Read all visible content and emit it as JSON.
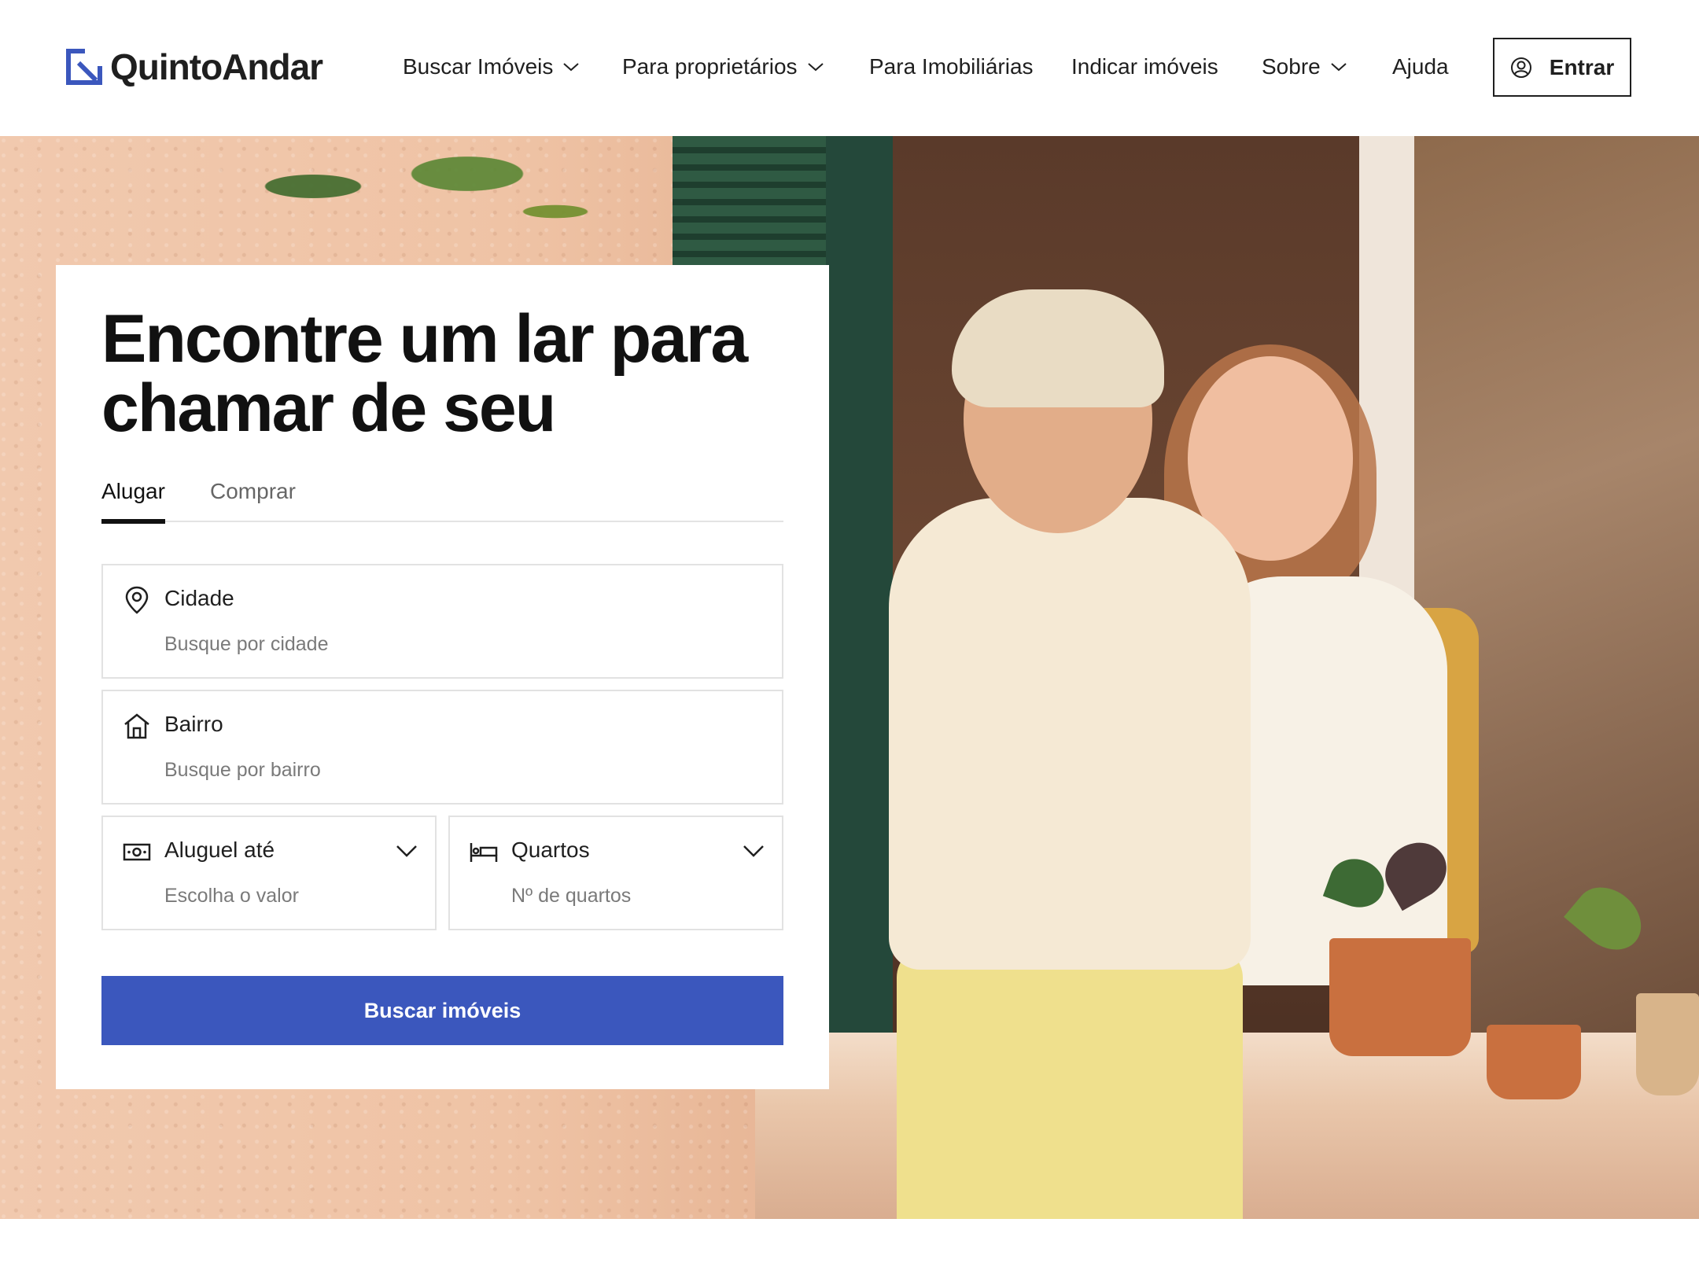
{
  "header": {
    "logo_text": "QuintoAndar",
    "nav": [
      {
        "label": "Buscar Imóveis",
        "has_dropdown": true
      },
      {
        "label": "Para proprietários",
        "has_dropdown": true
      },
      {
        "label": "Para Imobiliárias",
        "has_dropdown": false
      },
      {
        "label": "Indicar imóveis",
        "has_dropdown": false
      },
      {
        "label": "Sobre",
        "has_dropdown": true
      },
      {
        "label": "Ajuda",
        "has_dropdown": false
      }
    ],
    "login_label": "Entrar"
  },
  "search": {
    "title": "Encontre um lar para chamar de seu",
    "tabs": [
      {
        "label": "Alugar",
        "active": true
      },
      {
        "label": "Comprar",
        "active": false
      }
    ],
    "fields": {
      "city": {
        "label": "Cidade",
        "placeholder": "Busque por cidade",
        "icon": "location-pin-icon"
      },
      "neighborhood": {
        "label": "Bairro",
        "placeholder": "Busque por bairro",
        "icon": "house-icon"
      },
      "rent": {
        "label": "Aluguel até",
        "placeholder": "Escolha o valor",
        "icon": "money-icon"
      },
      "rooms": {
        "label": "Quartos",
        "placeholder": "Nº de quartos",
        "icon": "bed-icon"
      }
    },
    "submit_label": "Buscar imóveis"
  },
  "colors": {
    "brand_blue": "#3b57bd",
    "text": "#1f1f1f",
    "placeholder": "#7a7a7a"
  }
}
